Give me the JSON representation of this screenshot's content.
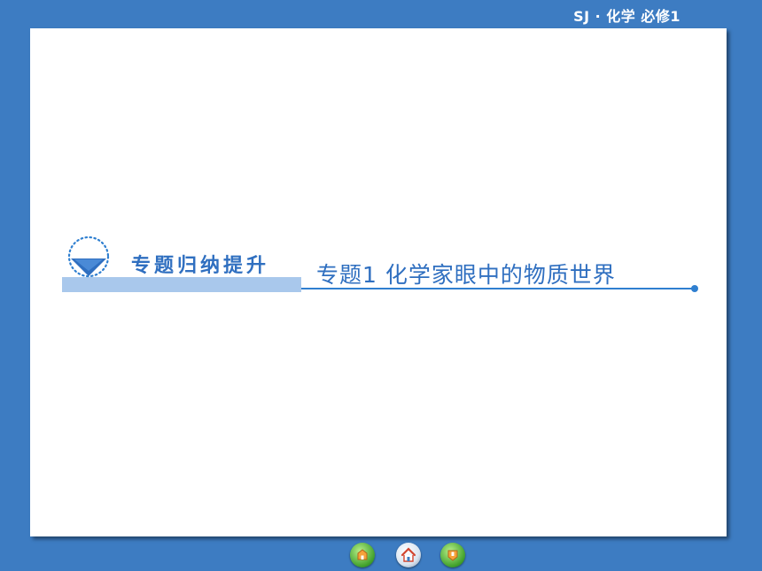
{
  "header": {
    "course_label": "SJ · 化学  必修1"
  },
  "slide": {
    "section_title": "专题归纳提升",
    "topic_title": "专题1  化学家眼中的物质世界"
  },
  "nav": {
    "prev_icon": "back-arrow-icon",
    "home_icon": "home-icon",
    "next_icon": "forward-arrow-icon"
  },
  "colors": {
    "background": "#3d7cc2",
    "accent": "#2f6fc0",
    "band": "#a9c8ec"
  }
}
